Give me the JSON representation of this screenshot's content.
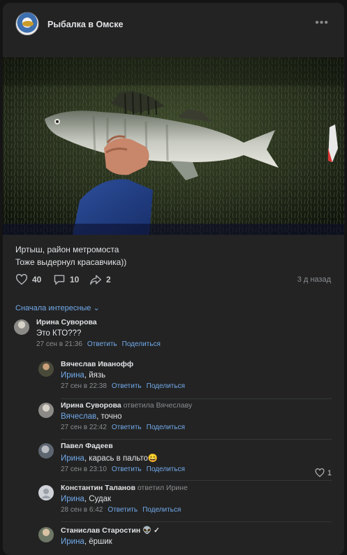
{
  "post": {
    "group_name": "Рыбалка в Омске",
    "text_line1": "Иртыш, район метромоста",
    "text_line2": "Тоже выдернул красавчика))",
    "likes": "40",
    "comments": "10",
    "shares": "2",
    "time": "3 д назад"
  },
  "sort_label": "Сначала интересные",
  "actions": {
    "reply": "Ответить",
    "share": "Поделиться"
  },
  "comments": [
    {
      "author": "Ирина Суворова",
      "replied": "",
      "mention": "",
      "text": "Это КТО???",
      "time": "27 сен в 21:36"
    },
    {
      "author": "Вячеслав Иванофф",
      "replied": "",
      "mention": "Ирина",
      "text": ", йязь",
      "time": "27 сен в 22:38"
    },
    {
      "author": "Ирина Суворова",
      "replied": "ответила Вячеславу",
      "mention": "Вячеслав",
      "text": ", точно",
      "time": "27 сен в 22:42"
    },
    {
      "author": "Павел Фадеев",
      "replied": "",
      "mention": "Ирина",
      "text": ", карась в пальто😄",
      "time": "27 сен в 23:10",
      "likes": "1"
    },
    {
      "author": "Константин Таланов",
      "replied": "ответил Ирине",
      "mention": "Ирина",
      "text": ", Судак",
      "time": "28 сен в 6:42"
    },
    {
      "author": "Станислав Старостин 👽 ✓",
      "replied": "",
      "mention": "Ирина",
      "text": ", ёршик",
      "time": ""
    }
  ],
  "colors": {
    "accent": "#71aaeb",
    "card": "#232323",
    "background": "#141414"
  },
  "icons": [
    "more-icon",
    "heart-icon",
    "comment-icon",
    "share-icon",
    "chevron-down-icon"
  ]
}
